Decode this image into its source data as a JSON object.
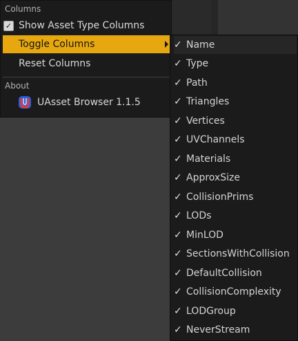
{
  "colors": {
    "menu_background": "#1b1b1b",
    "highlight": "#e7a70f",
    "text": "#d8d8d8",
    "section_text": "#b3b3b3"
  },
  "menu": {
    "columns_header": "Columns",
    "show_asset_type_columns": {
      "label": "Show Asset Type Columns",
      "checked": true
    },
    "toggle_columns_label": "Toggle Columns",
    "reset_columns_label": "Reset Columns",
    "about_header": "About",
    "about_item_label": "UAsset Browser 1.1.5"
  },
  "submenu": {
    "items": [
      {
        "label": "Name",
        "checked": true,
        "check_glyph": "✓"
      },
      {
        "label": "Type",
        "checked": true,
        "check_glyph": "✓"
      },
      {
        "label": "Path",
        "checked": true,
        "check_glyph": "✓"
      },
      {
        "label": "Triangles",
        "checked": true,
        "check_glyph": "✓"
      },
      {
        "label": "Vertices",
        "checked": true,
        "check_glyph": "✓"
      },
      {
        "label": "UVChannels",
        "checked": true,
        "check_glyph": "✓"
      },
      {
        "label": "Materials",
        "checked": true,
        "check_glyph": "✓"
      },
      {
        "label": "ApproxSize",
        "checked": true,
        "check_glyph": "✓"
      },
      {
        "label": "CollisionPrims",
        "checked": true,
        "check_glyph": "✓"
      },
      {
        "label": "LODs",
        "checked": true,
        "check_glyph": "✓"
      },
      {
        "label": "MinLOD",
        "checked": true,
        "check_glyph": "✓"
      },
      {
        "label": "SectionsWithCollision",
        "checked": true,
        "check_glyph": "✓"
      },
      {
        "label": "DefaultCollision",
        "checked": true,
        "check_glyph": "✓"
      },
      {
        "label": "CollisionComplexity",
        "checked": true,
        "check_glyph": "✓"
      },
      {
        "label": "LODGroup",
        "checked": true,
        "check_glyph": "✓"
      },
      {
        "label": "NeverStream",
        "checked": true,
        "check_glyph": "✓"
      }
    ]
  }
}
